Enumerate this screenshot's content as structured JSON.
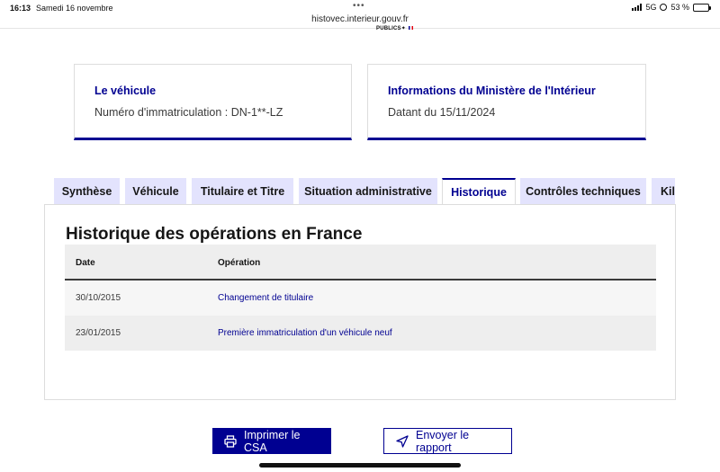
{
  "status_bar": {
    "time": "16:13",
    "date": "Samedi 16 novembre",
    "dots": "•••",
    "url": "histovec.interieur.gouv.fr",
    "network": "5G",
    "battery_text": "53 %",
    "battery_level": 0.53
  },
  "logo_fragment": "PUBLICS",
  "cards": [
    {
      "title": "Le véhicule",
      "text": "Numéro d'immatriculation : DN-1**-LZ"
    },
    {
      "title": "Informations du Ministère de l'Intérieur",
      "text": "Datant du 15/11/2024"
    }
  ],
  "tabs": [
    {
      "label": "Synthèse",
      "active": false
    },
    {
      "label": "Véhicule",
      "active": false
    },
    {
      "label": "Titulaire et Titre",
      "active": false
    },
    {
      "label": "Situation administrative",
      "active": false
    },
    {
      "label": "Historique",
      "active": true
    },
    {
      "label": "Contrôles techniques",
      "active": false
    },
    {
      "label": "Kilo",
      "active": false
    }
  ],
  "history": {
    "title": "Historique des opérations en France",
    "columns": [
      "Date",
      "Opération"
    ],
    "rows": [
      {
        "date": "30/10/2015",
        "operation": "Changement de titulaire"
      },
      {
        "date": "23/01/2015",
        "operation": "Première immatriculation d'un véhicule neuf"
      }
    ]
  },
  "actions": {
    "print_label": "Imprimer le CSA",
    "send_label": "Envoyer le rapport"
  },
  "colors": {
    "primary": "#000091",
    "tab_background": "#e3e3fd",
    "table_header": "#eeeeee"
  }
}
